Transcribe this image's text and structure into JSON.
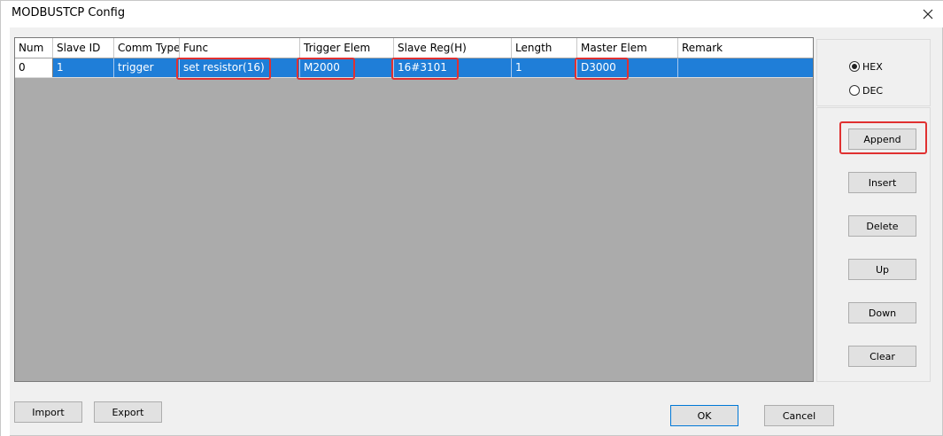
{
  "window": {
    "title": "MODBUSTCP Config"
  },
  "table": {
    "columns": [
      "Num",
      "Slave ID",
      "Comm Type",
      "Func",
      "Trigger Elem",
      "Slave Reg(H)",
      "Length",
      "Master Elem",
      "Remark"
    ],
    "rows": [
      {
        "num": "0",
        "slave_id": "1",
        "comm_type": "trigger",
        "func": "set resistor(16)",
        "trigger_elem": "M2000",
        "slave_reg": "16#3101",
        "length": "1",
        "master_elem": "D3000",
        "remark": ""
      }
    ]
  },
  "format": {
    "hex_label": "HEX",
    "dec_label": "DEC",
    "selected": "HEX"
  },
  "buttons": {
    "append": "Append",
    "insert": "Insert",
    "delete": "Delete",
    "up": "Up",
    "down": "Down",
    "clear": "Clear",
    "import": "Import",
    "export": "Export",
    "ok": "OK",
    "cancel": "Cancel"
  },
  "colors": {
    "selection": "#1f7ed8",
    "highlight": "#e03131",
    "grid_bg": "#ababab"
  }
}
